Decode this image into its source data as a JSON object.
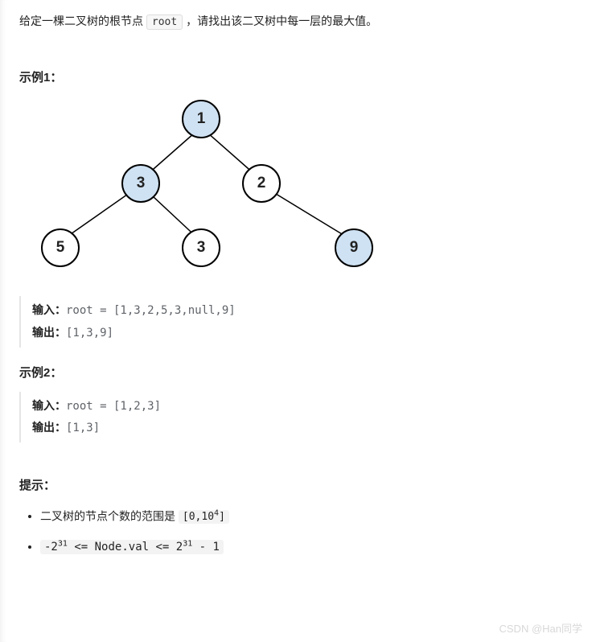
{
  "desc_part1": "给定一棵二叉树的根节点 ",
  "desc_code": "root",
  "desc_part2": " ，请找出该二叉树中每一层的最大值。",
  "example1_title": "示例1：",
  "tree": {
    "n1": "1",
    "n3a": "3",
    "n2": "2",
    "n5": "5",
    "n3b": "3",
    "n9": "9"
  },
  "ex1": {
    "input_label": "输入：",
    "input_value": "root = [1,3,2,5,3,null,9]",
    "output_label": "输出：",
    "output_value": "[1,3,9]"
  },
  "example2_title": "示例2：",
  "ex2": {
    "input_label": "输入：",
    "input_value": "root = [1,2,3]",
    "output_label": "输出：",
    "output_value": "[1,3]"
  },
  "hints_title": "提示：",
  "hint1_part1": "二叉树的节点个数的范围是 ",
  "hint1_range_a": "[0,10",
  "hint1_range_sup": "4",
  "hint1_range_b": "]",
  "hint2_a": "-2",
  "hint2_exp1": "31",
  "hint2_mid": " <= Node.val <= 2",
  "hint2_exp2": "31",
  "hint2_b": " - 1",
  "watermark": "CSDN @Han同学"
}
